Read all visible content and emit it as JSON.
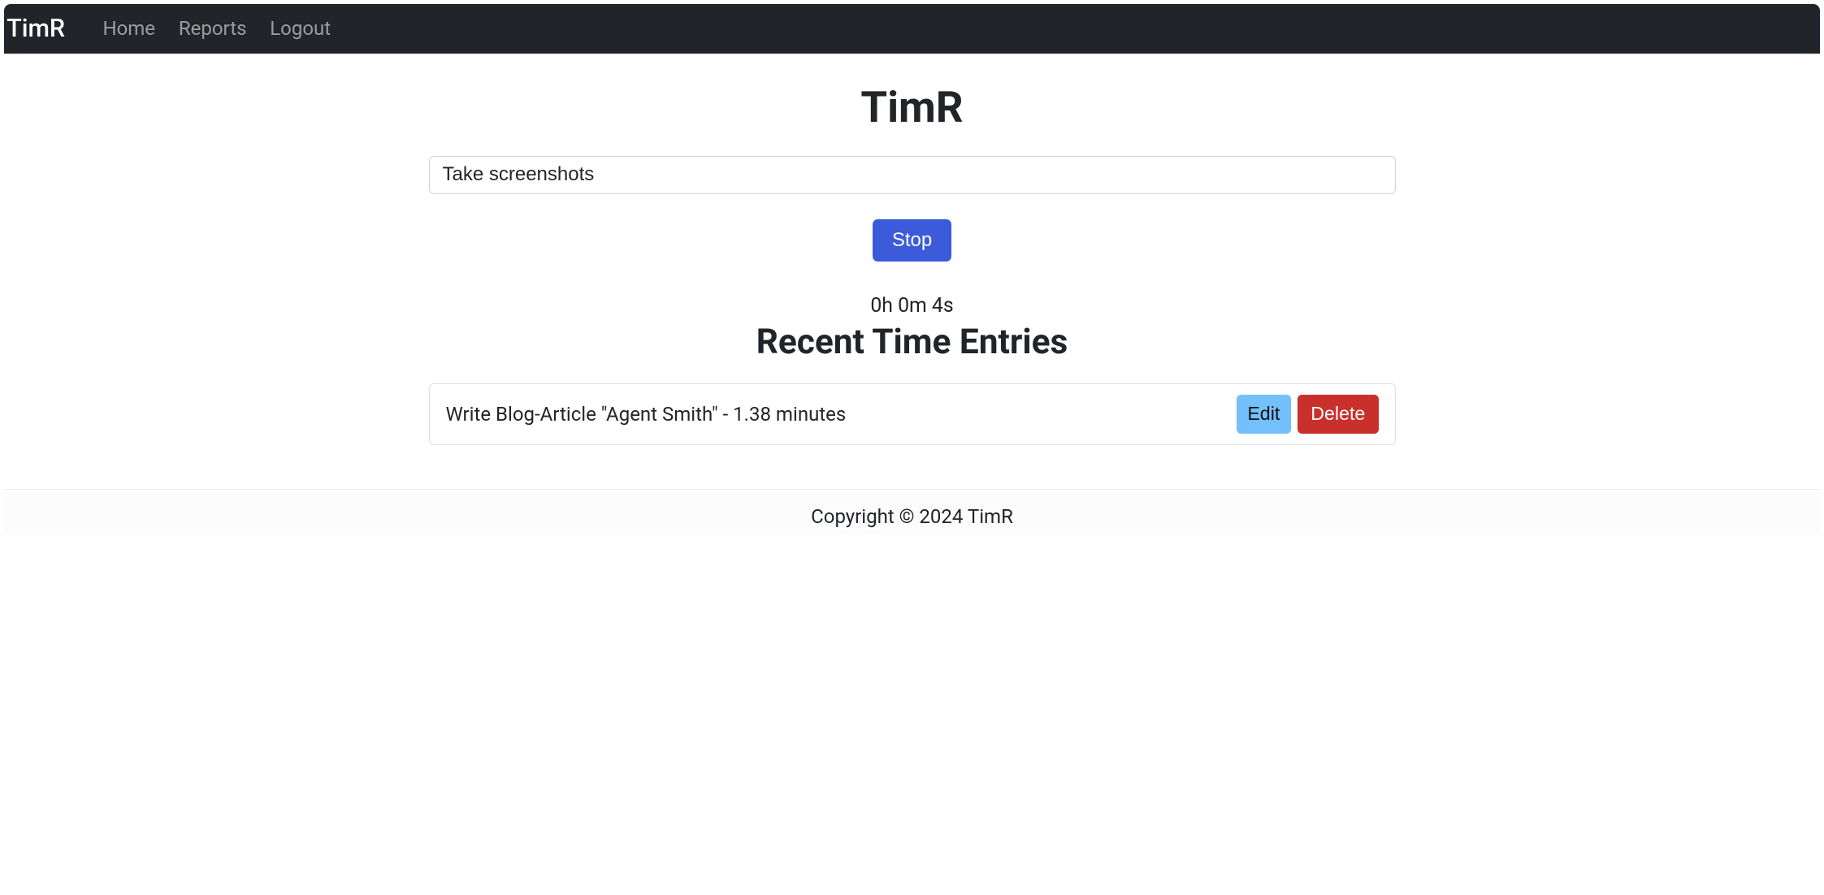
{
  "navbar": {
    "brand": "TimR",
    "links": [
      {
        "label": "Home"
      },
      {
        "label": "Reports"
      },
      {
        "label": "Logout"
      }
    ]
  },
  "main": {
    "title": "TimR",
    "task_input_value": "Take screenshots",
    "stop_button_label": "Stop",
    "elapsed_time": "0h 0m 4s",
    "recent_heading": "Recent Time Entries",
    "entries": [
      {
        "text": "Write Blog-Article \"Agent Smith\" - 1.38 minutes",
        "edit_label": "Edit",
        "delete_label": "Delete"
      }
    ]
  },
  "footer": {
    "text": "Copyright © 2024 TimR"
  }
}
